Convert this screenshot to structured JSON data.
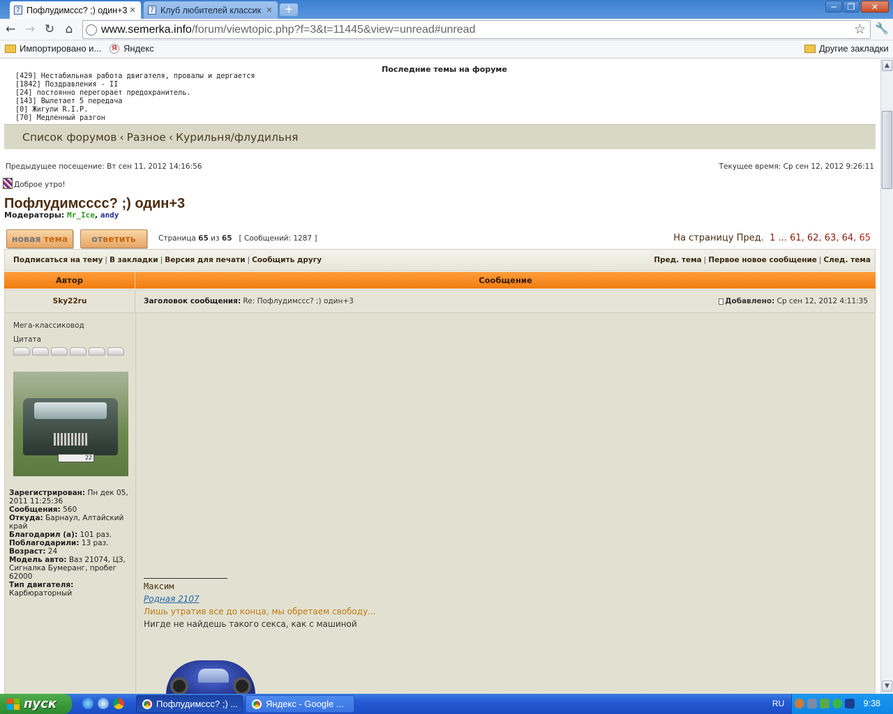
{
  "browser": {
    "tabs": [
      {
        "title": "Пофлудимссс? ;) один+3",
        "active": true
      },
      {
        "title": "Клуб любителей классик",
        "active": false
      }
    ],
    "url_host": "www.semerka.info",
    "url_path": "/forum/viewtopic.php?f=3&t=11445&view=unread#unread",
    "bookmarks": [
      "Импортировано и...",
      "Яндекс"
    ],
    "other_bookmarks": "Другие закладки",
    "window_buttons": [
      "minimize-icon",
      "maximize-icon",
      "close-icon"
    ]
  },
  "latest": {
    "title": "Последние темы на форуме",
    "items": [
      "[429] Нестабильная работа двигателя, провалы и дергается",
      "[1842] Поздравления - II",
      "[24] постоянно перегорает предохранитель.",
      "[143] Вылетает 5 передача",
      "[0] Жигули R.I.P.",
      "[70] Медленный разгон"
    ]
  },
  "breadcrumb": [
    "Список форумов",
    "Разное",
    "Курильня/флудильня"
  ],
  "visit": {
    "previous": "Предыдущее посещение: Вт сен 11, 2012 14:16:56",
    "current": "Текущее время: Ср сен 12, 2012 9:26:11"
  },
  "greeting": "Доброе утро!",
  "topic": {
    "title": "Пофлудимсссс? ;) один+3",
    "moderators_label": "Модераторы:",
    "moderators": [
      "Mr_Ice",
      "andy"
    ]
  },
  "buttons": {
    "new_topic": [
      "новая",
      "тема"
    ],
    "reply": [
      "от",
      "ветить"
    ]
  },
  "pageinfo": {
    "prefix": "Страница",
    "page": "65",
    "of": "из",
    "total": "65",
    "posts": "[ Сообщений: 1287 ]"
  },
  "pagenav": {
    "label": "На страницу",
    "prev": "Пред.",
    "first": "1",
    "ellipsis": "...",
    "pages": [
      "61",
      "62",
      "63",
      "64"
    ],
    "current": "65"
  },
  "actions_left": [
    "Подписаться на тему",
    "В закладки",
    "Версия для печати",
    "Сообщить другу"
  ],
  "actions_right": [
    "Пред. тема",
    "Первое новое сообщение",
    "След. тема"
  ],
  "table": {
    "author": "Автор",
    "message": "Сообщение"
  },
  "post": {
    "author": "Sky22ru",
    "subject_label": "Заголовок сообщения:",
    "subject": "Re: Пофлудимссс? ;) один+3",
    "added_label": "Добавлено:",
    "added": "Ср сен 12, 2012 4:11:35",
    "rank": "Мега-классиковод",
    "quote_label": "Цитата",
    "stars": 6,
    "profile": [
      {
        "label": "Зарегистрирован:",
        "value": "Пн дек 05, 2011 11:25:36"
      },
      {
        "label": "Сообщения:",
        "value": "560"
      },
      {
        "label": "Откуда:",
        "value": "Барнаул, Алтайский край"
      },
      {
        "label": "Благодарил (а):",
        "value": "101 раз."
      },
      {
        "label": "Поблагодарили:",
        "value": "13 раз."
      },
      {
        "label": "Возраст:",
        "value": "24"
      },
      {
        "label": "Модель авто:",
        "value": "Ваз 21074, ЦЗ, Сигналка Бумеранг, пробег 62000"
      },
      {
        "label": "Тип двигателя:",
        "value": "Карбюраторный"
      }
    ],
    "avatar_plate": "22",
    "signature": {
      "name": "Максим",
      "link": "Родная 2107",
      "quote": "Лишь утратив все до конца, мы обретаем свободу...",
      "text": "Нигде не найдешь такого секса, как с машиной"
    }
  },
  "taskbar": {
    "start": "пуск",
    "tasks": [
      "Пофлудимссс? ;) ...",
      "Яндекс - Google ..."
    ],
    "lang": "RU",
    "clock": "9:38"
  }
}
